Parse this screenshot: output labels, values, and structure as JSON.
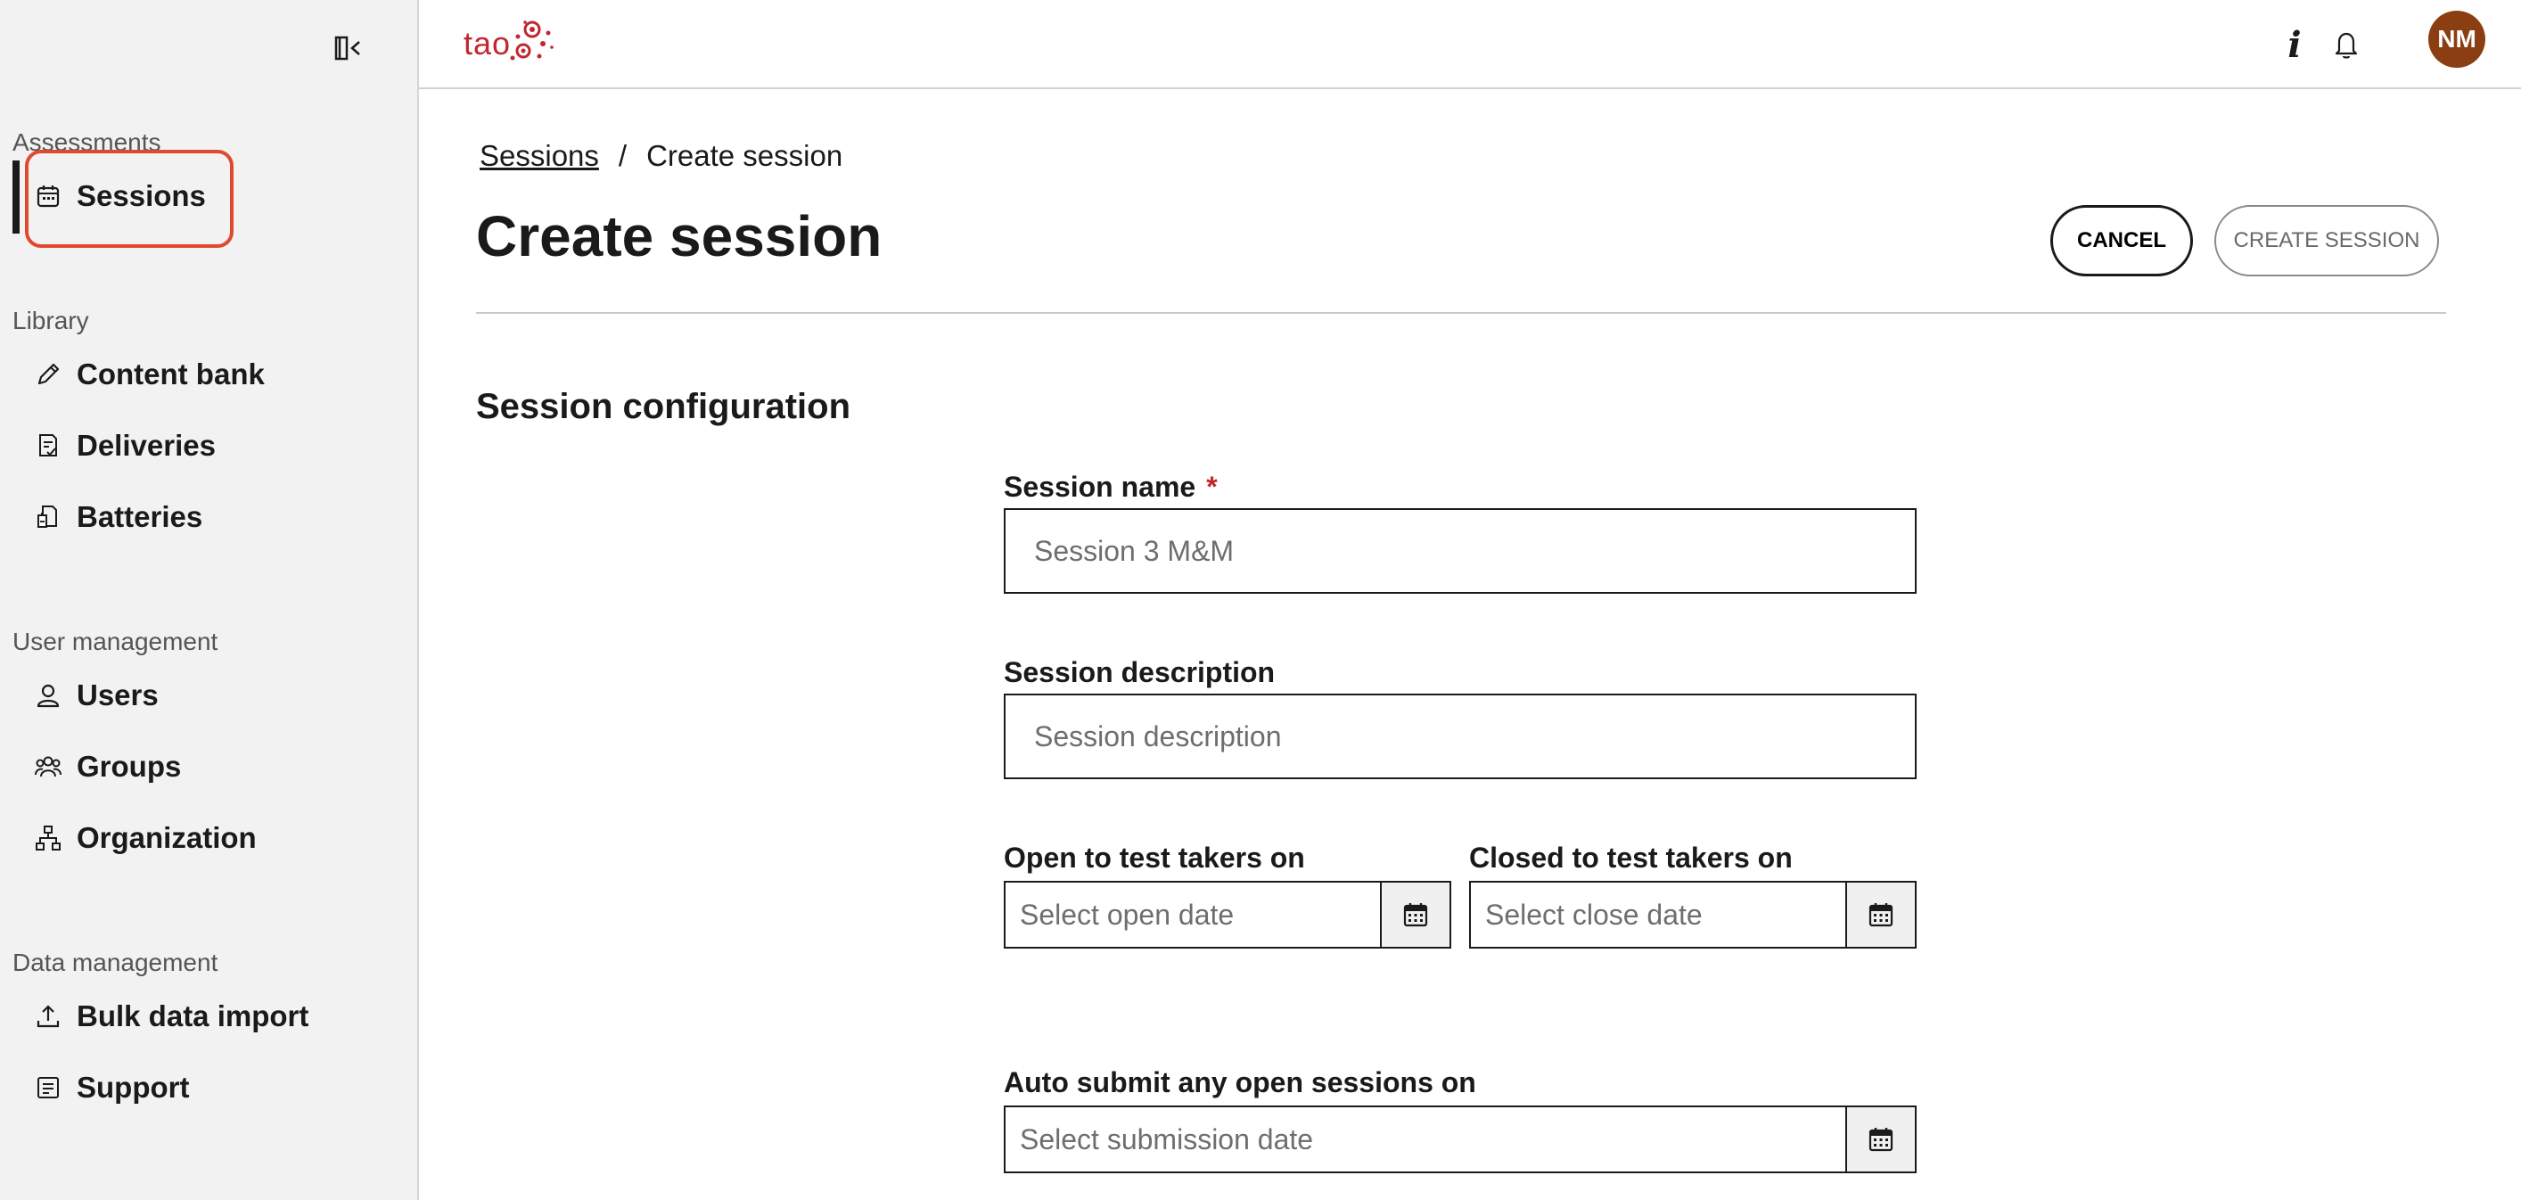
{
  "sidebar": {
    "sections": [
      {
        "label": "Assessments",
        "items": [
          {
            "label": "Sessions",
            "icon": "calendar-icon"
          }
        ]
      },
      {
        "label": "Library",
        "items": [
          {
            "label": "Content bank",
            "icon": "pencil-icon"
          },
          {
            "label": "Deliveries",
            "icon": "delivery-list-icon"
          },
          {
            "label": "Batteries",
            "icon": "battery-doc-icon"
          }
        ]
      },
      {
        "label": "User management",
        "items": [
          {
            "label": "Users",
            "icon": "user-icon"
          },
          {
            "label": "Groups",
            "icon": "group-icon"
          },
          {
            "label": "Organization",
            "icon": "org-chart-icon"
          }
        ]
      },
      {
        "label": "Data management",
        "items": [
          {
            "label": "Bulk data import",
            "icon": "upload-icon"
          },
          {
            "label": "Support",
            "icon": "support-doc-icon"
          }
        ]
      }
    ]
  },
  "topbar": {
    "logo_text": "tao",
    "avatar_initials": "NM",
    "info_label": "i",
    "brand_color": "#c0282e",
    "avatar_color": "#8b3e12"
  },
  "breadcrumb": {
    "parent": "Sessions",
    "separator": "/",
    "current": "Create session"
  },
  "page": {
    "title": "Create session",
    "cancel_label": "CANCEL",
    "create_label": "CREATE SESSION"
  },
  "form": {
    "section_title": "Session configuration",
    "name_label": "Session name",
    "name_required_marker": "*",
    "name_placeholder": "Session 3 M&M",
    "description_label": "Session description",
    "description_placeholder": "Session description",
    "open_label": "Open to test takers on",
    "open_placeholder": "Select open date",
    "close_label": "Closed to test takers on",
    "close_placeholder": "Select close date",
    "autosubmit_label": "Auto submit any open sessions on",
    "autosubmit_placeholder": "Select submission date"
  }
}
